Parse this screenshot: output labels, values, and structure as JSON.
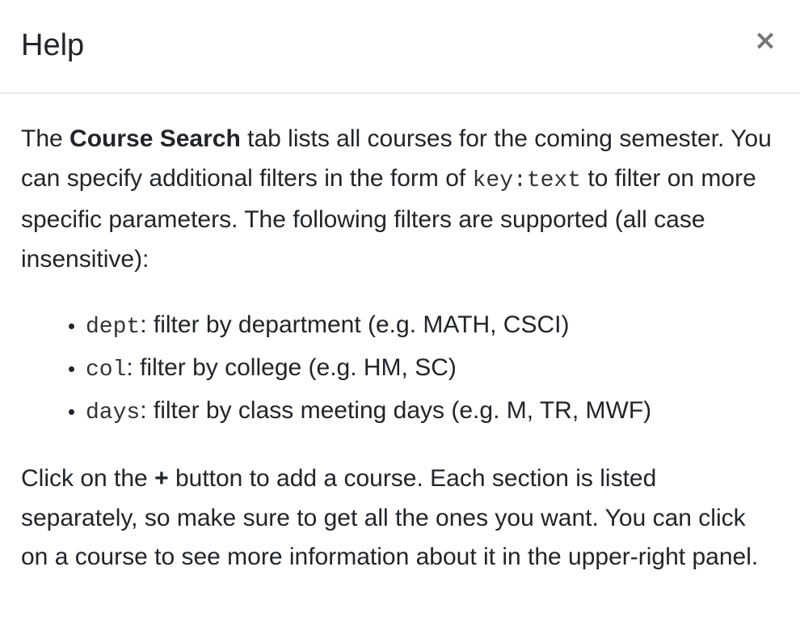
{
  "dialog": {
    "title": "Help",
    "close_label": "×"
  },
  "intro": {
    "part1": "The ",
    "bold": "Course Search",
    "part2": " tab lists all courses for the coming semester. You can specify additional filters in the form of ",
    "code": "key:text",
    "part3": " to filter on more specific parameters. The following filters are supported (all case insensitive):"
  },
  "filters": [
    {
      "key": "dept",
      "description": ": filter by department (e.g. MATH, CSCI)"
    },
    {
      "key": "col",
      "description": ": filter by college (e.g. HM, SC)"
    },
    {
      "key": "days",
      "description": ": filter by class meeting days (e.g. M, TR, MWF)"
    }
  ],
  "outro": {
    "part1": "Click on the ",
    "bold": "+",
    "part2": " button to add a course. Each section is listed separately, so make sure to get all the ones you want. You can click on a course to see more information about it in the upper-right panel."
  }
}
